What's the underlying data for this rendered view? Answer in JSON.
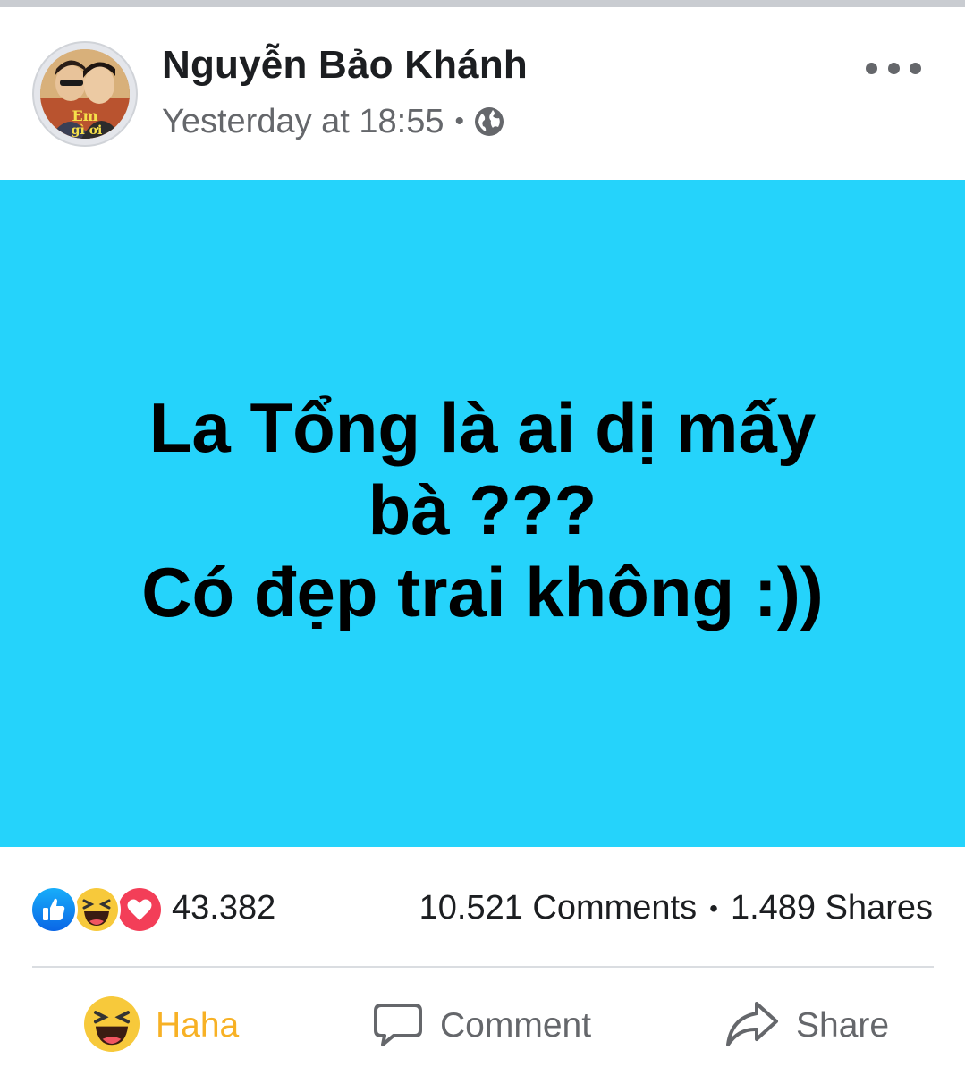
{
  "post": {
    "author": "Nguyễn Bảo Khánh",
    "timestamp": "Yesterday at 18:55",
    "separator": "•",
    "privacy_icon": "globe-icon",
    "more_icon": "more-options-icon",
    "body_text": "La Tổng là ai dị mấy\nbà ???\nCó đẹp trai không :))",
    "background_color": "#25d3fb"
  },
  "stats": {
    "reaction_icons": [
      "like-icon",
      "haha-icon",
      "love-icon"
    ],
    "reaction_count": "43.382",
    "comments": "10.521 Comments",
    "separator": "•",
    "shares": "1.489 Shares"
  },
  "actions": {
    "haha_label": "Haha",
    "comment_label": "Comment",
    "share_label": "Share"
  },
  "colors": {
    "accent_haha": "#f7b125",
    "like_blue": "#1877f2",
    "love_red": "#f33e58",
    "secondary_text": "#65676b"
  }
}
